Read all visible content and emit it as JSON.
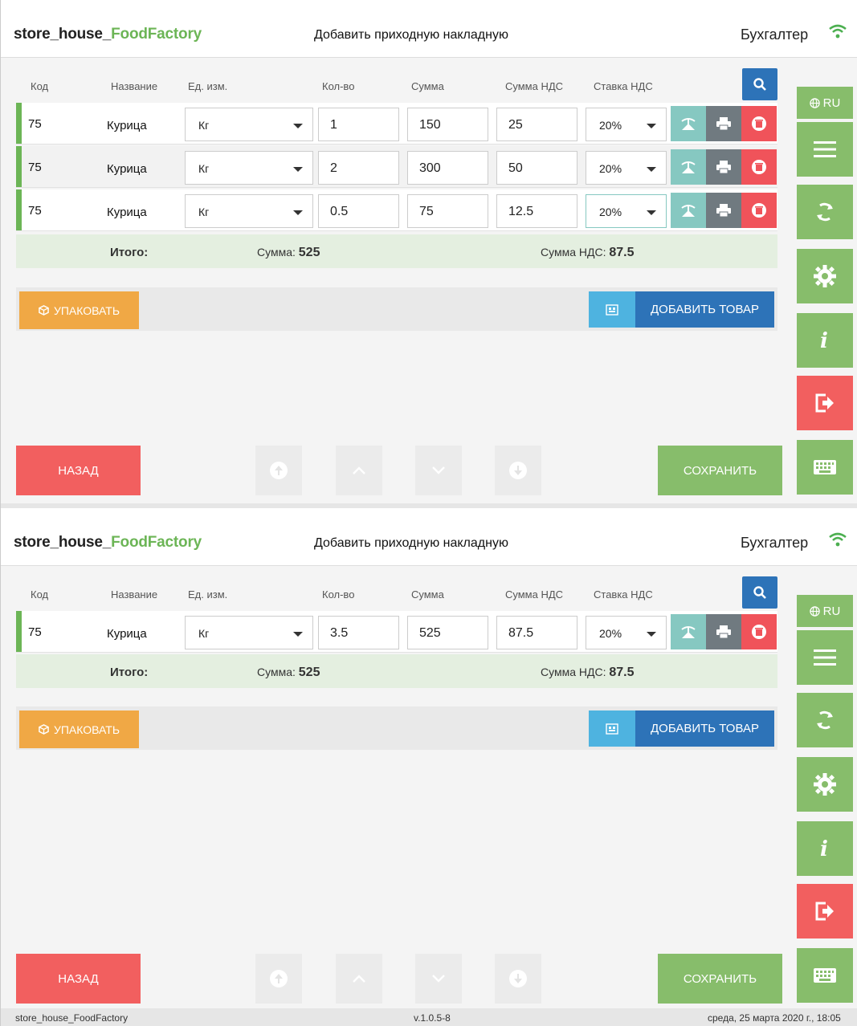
{
  "header": {
    "app_name": "store_house_",
    "brand": "FoodFactory",
    "page_title": "Добавить приходную накладную",
    "user_role": "Бухгалтер"
  },
  "columns": {
    "code": "Код",
    "name": "Название",
    "unit": "Ед. изм.",
    "qty": "Кол-во",
    "sum": "Сумма",
    "vat_sum": "Сумма НДС",
    "vat_rate": "Ставка НДС"
  },
  "screen1": {
    "rows": [
      {
        "code": "75",
        "name": "Курица",
        "unit": "Кг",
        "qty": "1",
        "sum": "150",
        "vat_sum": "25",
        "vat_rate": "20%"
      },
      {
        "code": "75",
        "name": "Курица",
        "unit": "Кг",
        "qty": "2",
        "sum": "300",
        "vat_sum": "50",
        "vat_rate": "20%"
      },
      {
        "code": "75",
        "name": "Курица",
        "unit": "Кг",
        "qty": "0.5",
        "sum": "75",
        "vat_sum": "12.5",
        "vat_rate": "20%"
      }
    ]
  },
  "screen2": {
    "rows": [
      {
        "code": "75",
        "name": "Курица",
        "unit": "Кг",
        "qty": "3.5",
        "sum": "525",
        "vat_sum": "87.5",
        "vat_rate": "20%"
      }
    ]
  },
  "totals": {
    "label": "Итого:",
    "sum_label": "Сумма: ",
    "sum_value": "525",
    "vat_label": "Сумма НДС: ",
    "vat_value": "87.5"
  },
  "toolbar": {
    "pack_label": "УПАКОВАТЬ",
    "add_label": "ДОБАВИТЬ ТОВАР"
  },
  "bottom": {
    "back_label": "НАЗАД",
    "save_label": "СОХРАНИТЬ"
  },
  "sidebar": {
    "lang_label": "RU"
  },
  "footer": {
    "app": "store_house_FoodFactory",
    "version": "v.1.0.5-8",
    "datetime": "среда, 25 марта 2020 г., 18:05"
  },
  "colors": {
    "brand_green": "#6cb556",
    "primary_blue": "#2d73b8",
    "danger_red": "#f25f5f",
    "warning_orange": "#f0a845",
    "teal": "#86c8c1"
  }
}
